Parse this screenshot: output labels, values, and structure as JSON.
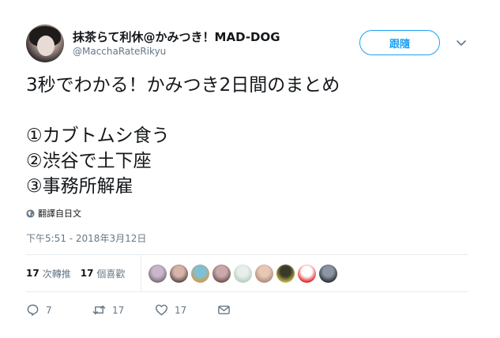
{
  "user": {
    "display_name": "抹茶らて利休@かみつき！MAD-DOG",
    "handle": "@MacchaRateRikyu"
  },
  "follow_button": {
    "label": "跟隨"
  },
  "tweet": {
    "lines": [
      "3秒でわかる！かみつき2日間のまとめ",
      "①カブトムシ食う",
      "②渋谷で土下座",
      "③事務所解雇"
    ],
    "translate_label": "翻譯自日文",
    "timestamp": "下午5:51 - 2018年3月12日"
  },
  "stats": {
    "retweets": {
      "count": "17",
      "label": "次轉推"
    },
    "likes": {
      "count": "17",
      "label": "個喜歡"
    }
  },
  "liker_avatars": [
    {
      "name": "liker-avatar-1",
      "colors": [
        "#c9b7c9",
        "#7a6b7d"
      ]
    },
    {
      "name": "liker-avatar-2",
      "colors": [
        "#d8b4a8",
        "#5a4b48"
      ]
    },
    {
      "name": "liker-avatar-3",
      "colors": [
        "#7ec1d6",
        "#d59a4c"
      ]
    },
    {
      "name": "liker-avatar-4",
      "colors": [
        "#c9a9a9",
        "#6e5454"
      ]
    },
    {
      "name": "liker-avatar-5",
      "colors": [
        "#e6efe9",
        "#b9cbbf"
      ]
    },
    {
      "name": "liker-avatar-6",
      "colors": [
        "#e7c8b7",
        "#b08a7a"
      ]
    },
    {
      "name": "liker-avatar-7",
      "colors": [
        "#3a3a2a",
        "#c9b84a"
      ]
    },
    {
      "name": "liker-avatar-8",
      "colors": [
        "#ffffff",
        "#e02020"
      ]
    },
    {
      "name": "liker-avatar-9",
      "colors": [
        "#8b95a3",
        "#2a2f36"
      ]
    }
  ],
  "actions": {
    "reply_count": "7",
    "retweet_count": "17",
    "like_count": "17"
  },
  "colors": {
    "accent": "#1da1f2",
    "muted": "#657786",
    "border": "#e6ecf0"
  }
}
